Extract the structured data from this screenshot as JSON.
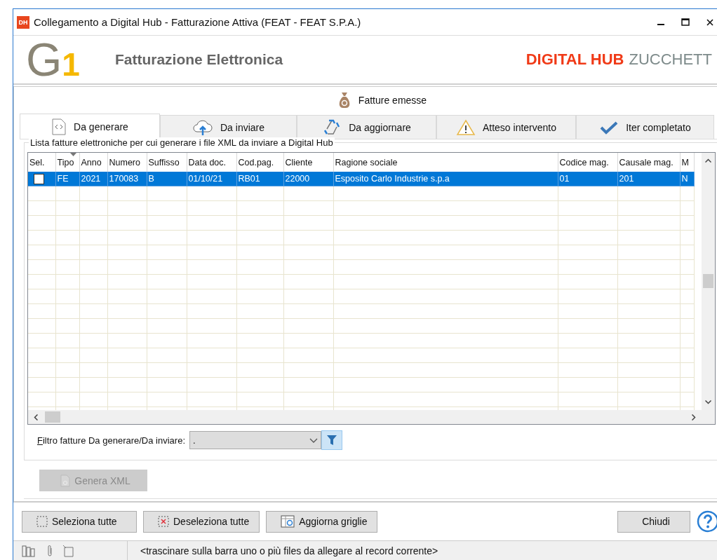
{
  "window": {
    "app_icon": "DH",
    "title": "Collegamento a Digital Hub - Fatturazione Attiva (FEAT - FEAT S.P.A.)"
  },
  "header": {
    "logo_letter": "G",
    "logo_digit": "1",
    "title": "Fatturazione Elettronica",
    "brand_bold": "DIGITAL HUB",
    "brand_light": "ZUCCHETT"
  },
  "section": {
    "title": "Fatture emesse"
  },
  "tabs": [
    {
      "label": "Da generare",
      "selected": true
    },
    {
      "label": "Da inviare",
      "selected": false
    },
    {
      "label": "Da aggiornare",
      "selected": false
    },
    {
      "label": "Atteso intervento",
      "selected": false
    },
    {
      "label": "Iter completato",
      "selected": false
    }
  ],
  "group": {
    "title": "Lista fatture elettroniche per cui generare i file XML da inviare a Digital Hub"
  },
  "table": {
    "columns": [
      "Sel.",
      "Tipo",
      "Anno",
      "Numero",
      "Suffisso",
      "Data doc.",
      "Cod.pag.",
      "Cliente",
      "Ragione sociale",
      "Codice mag.",
      "Causale mag.",
      "M"
    ],
    "rows": [
      {
        "selected": true,
        "checked": false,
        "cells": [
          "",
          "FE",
          "2021",
          "170083",
          "B",
          "01/10/21",
          "RB01",
          "22000",
          "Esposito Carlo Industrie s.p.a",
          "01",
          "201",
          "N"
        ]
      }
    ]
  },
  "filter": {
    "label": "Filtro fatture Da generare/Da inviare:",
    "value": "."
  },
  "generate_button": {
    "label": "Genera XML",
    "disabled": true
  },
  "buttons": [
    {
      "label": "Seleziona tutte"
    },
    {
      "label": "Deseleziona tutte"
    },
    {
      "label": "Aggiorna griglie"
    }
  ],
  "close_button": {
    "label": "Chiudi"
  },
  "status_bar": {
    "text": "<trascinare sulla barra uno o più files da allegare al record corrente>"
  }
}
